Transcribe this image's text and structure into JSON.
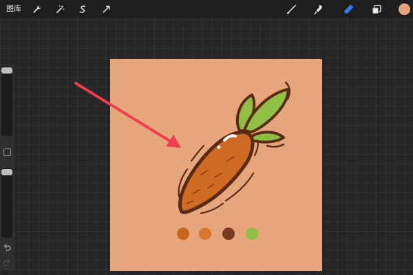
{
  "toolbar": {
    "gallery_label": "图库",
    "left_tools": [
      "wrench-icon",
      "magic-wand-icon",
      "selection-icon",
      "transform-arrow-icon"
    ],
    "right_tools": [
      "brush-icon",
      "smudge-icon",
      "eraser-icon",
      "layers-icon"
    ],
    "active_tool": "eraser-icon",
    "accent_color": "#2f7cf6",
    "current_color": "#e8a27a"
  },
  "sidebar": {
    "size_slider_value": 1.0,
    "opacity_slider_value": 1.0
  },
  "canvas": {
    "background_color": "#e6a57b",
    "palette": [
      "#c8641e",
      "#d9762b",
      "#7a3a22",
      "#8fbf45"
    ]
  },
  "annotation": {
    "arrow_color": "#ee3d4c"
  }
}
